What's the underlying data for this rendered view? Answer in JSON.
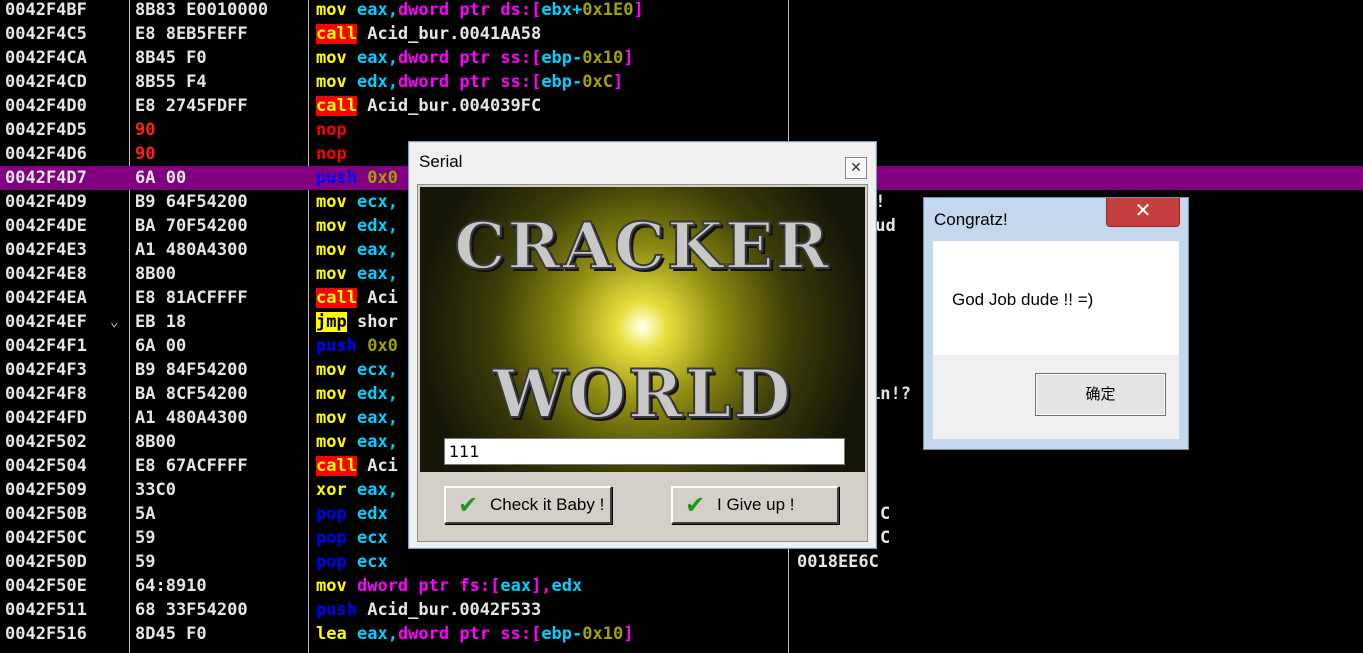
{
  "disasm": {
    "rows": [
      {
        "addr": "0042F4BF",
        "hex": "8B83 E0010000",
        "mn": "mov",
        "ops": "eax,dword ptr ds:[ebx+0x1E0]",
        "extra": ""
      },
      {
        "addr": "0042F4C5",
        "hex": "E8 8EB5FEFF",
        "mn": "call",
        "ops": "Acid_bur.0041AA58",
        "extra": ""
      },
      {
        "addr": "0042F4CA",
        "hex": "8B45 F0",
        "mn": "mov",
        "ops": "eax,dword ptr ss:[ebp-0x10]",
        "extra": ""
      },
      {
        "addr": "0042F4CD",
        "hex": "8B55 F4",
        "mn": "mov",
        "ops": "edx,dword ptr ss:[ebp-0xC]",
        "extra": ""
      },
      {
        "addr": "0042F4D0",
        "hex": "E8 2745FDFF",
        "mn": "call",
        "ops": "Acid_bur.004039FC",
        "extra": ""
      },
      {
        "addr": "0042F4D5",
        "hex": "90",
        "mn": "nop",
        "ops": "",
        "extra": ""
      },
      {
        "addr": "0042F4D6",
        "hex": "90",
        "mn": "nop",
        "ops": "",
        "extra": ""
      },
      {
        "addr": "0042F4D7",
        "hex": "6A 00",
        "mn": "push",
        "ops": "0x0",
        "extra": ""
      },
      {
        "addr": "0042F4D9",
        "hex": "B9 64F54200",
        "mn": "mov",
        "ops": "ecx,",
        "extra": "z!"
      },
      {
        "addr": "0042F4DE",
        "hex": "BA 70F54200",
        "mn": "mov",
        "ops": "edx,",
        "extra": "dud"
      },
      {
        "addr": "0042F4E3",
        "hex": "A1 480A4300",
        "mn": "mov",
        "ops": "eax,",
        "extra": ""
      },
      {
        "addr": "0042F4E8",
        "hex": "8B00",
        "mn": "mov",
        "ops": "eax,",
        "extra": ""
      },
      {
        "addr": "0042F4EA",
        "hex": "E8 81ACFFFF",
        "mn": "call",
        "ops": "Aci",
        "extra": ""
      },
      {
        "addr": "0042F4EF",
        "hex": "EB 18",
        "mn": "jmp",
        "ops": "shor",
        "extra": "",
        "mark": "⌄"
      },
      {
        "addr": "0042F4F1",
        "hex": "6A 00",
        "mn": "push",
        "ops": "0x0",
        "extra": ""
      },
      {
        "addr": "0042F4F3",
        "hex": "B9 84F54200",
        "mn": "mov",
        "ops": "ecx,",
        "extra": ""
      },
      {
        "addr": "0042F4F8",
        "hex": "BA 8CF54200",
        "mn": "mov",
        "ops": "edx,",
        "extra": "in!?"
      },
      {
        "addr": "0042F4FD",
        "hex": "A1 480A4300",
        "mn": "mov",
        "ops": "eax,",
        "extra": ""
      },
      {
        "addr": "0042F502",
        "hex": "8B00",
        "mn": "mov",
        "ops": "eax,",
        "extra": ""
      },
      {
        "addr": "0042F504",
        "hex": "E8 67ACFFFF",
        "mn": "call",
        "ops": "Aci",
        "extra": ""
      },
      {
        "addr": "0042F509",
        "hex": "33C0",
        "mn": "xor",
        "ops": "eax,",
        "extra": ""
      },
      {
        "addr": "0042F50B",
        "hex": "5A",
        "mn": "pop",
        "ops": "edx",
        "extra": "C"
      },
      {
        "addr": "0042F50C",
        "hex": "59",
        "mn": "pop",
        "ops": "ecx",
        "extra": "C"
      },
      {
        "addr": "0042F50D",
        "hex": "59",
        "mn": "pop",
        "ops": "ecx",
        "extra": "0018EE6C"
      },
      {
        "addr": "0042F50E",
        "hex": "64:8910",
        "mn": "mov",
        "ops": "dword ptr fs:[eax],edx",
        "extra": ""
      },
      {
        "addr": "0042F511",
        "hex": "68 33F54200",
        "mn": "push",
        "ops": "Acid_bur.0042F533",
        "extra": ""
      },
      {
        "addr": "0042F516",
        "hex": "8D45 F0",
        "mn": "lea",
        "ops": "eax,dword ptr ss:[ebp-0x10]",
        "extra": ""
      }
    ]
  },
  "serial": {
    "title": "Serial",
    "close_glyph": "✕",
    "banner_line1": "CRACKER",
    "banner_line2": "WORLD",
    "input_value": "111",
    "check_button": "Check it Baby !",
    "giveup_button": "I Give up !",
    "check_glyph": "✔"
  },
  "congratz": {
    "title": "Congratz!",
    "close_glyph": "✕",
    "message": "God Job dude !! =)",
    "ok_button": "确定"
  },
  "colors": {
    "highlight": "#800080",
    "call_bg": "#ff0000",
    "jmp_bg": "#ffff00"
  }
}
